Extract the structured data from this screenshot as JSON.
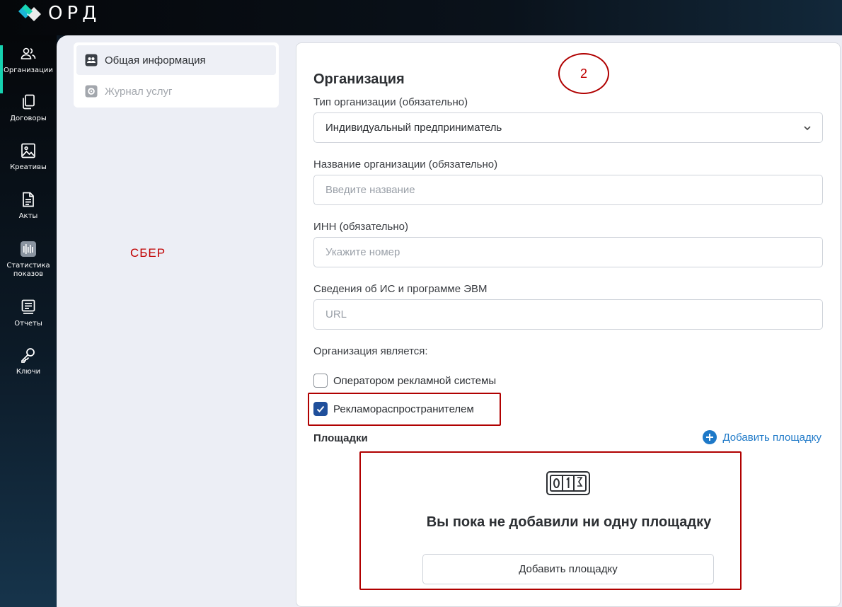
{
  "app": {
    "logo_text": "ОРД"
  },
  "sidebar": {
    "items": [
      {
        "label": "Организации",
        "icon": "users-icon",
        "active": true
      },
      {
        "label": "Договоры",
        "icon": "documents-icon"
      },
      {
        "label": "Креативы",
        "icon": "image-icon"
      },
      {
        "label": "Акты",
        "icon": "file-text-icon"
      },
      {
        "label": "Статистика показов",
        "icon": "statistics-icon"
      },
      {
        "label": "Отчеты",
        "icon": "report-icon"
      },
      {
        "label": "Ключи",
        "icon": "key-icon"
      }
    ]
  },
  "left_menu": {
    "general": "Общая информация",
    "services": "Журнал услуг"
  },
  "annotations": {
    "sber": "СБЕР",
    "step": "2",
    "color": "#b00000"
  },
  "form": {
    "title": "Организация",
    "org_type": {
      "label": "Тип организации (обязательно)",
      "value": "Индивидуальный предприниматель"
    },
    "org_name": {
      "label": "Название организации (обязательно)",
      "placeholder": "Введите название"
    },
    "inn": {
      "label": "ИНН (обязательно)",
      "placeholder": "Укажите номер"
    },
    "is_info": {
      "label": "Сведения об ИС и программе ЭВМ",
      "placeholder": "URL"
    },
    "role_label": "Организация является:",
    "roles": [
      {
        "label": "Оператором рекламной системы",
        "checked": false
      },
      {
        "label": "Рекламораспространителем",
        "checked": true
      }
    ],
    "platforms": {
      "title": "Площадки",
      "add_link": "Добавить площадку",
      "empty_text": "Вы пока не добавили ни одну площадку",
      "add_button": "Добавить площадку"
    }
  },
  "colors": {
    "accent": "#16d2b0",
    "link": "#1e79c8",
    "checkbox": "#1f4f9b"
  }
}
